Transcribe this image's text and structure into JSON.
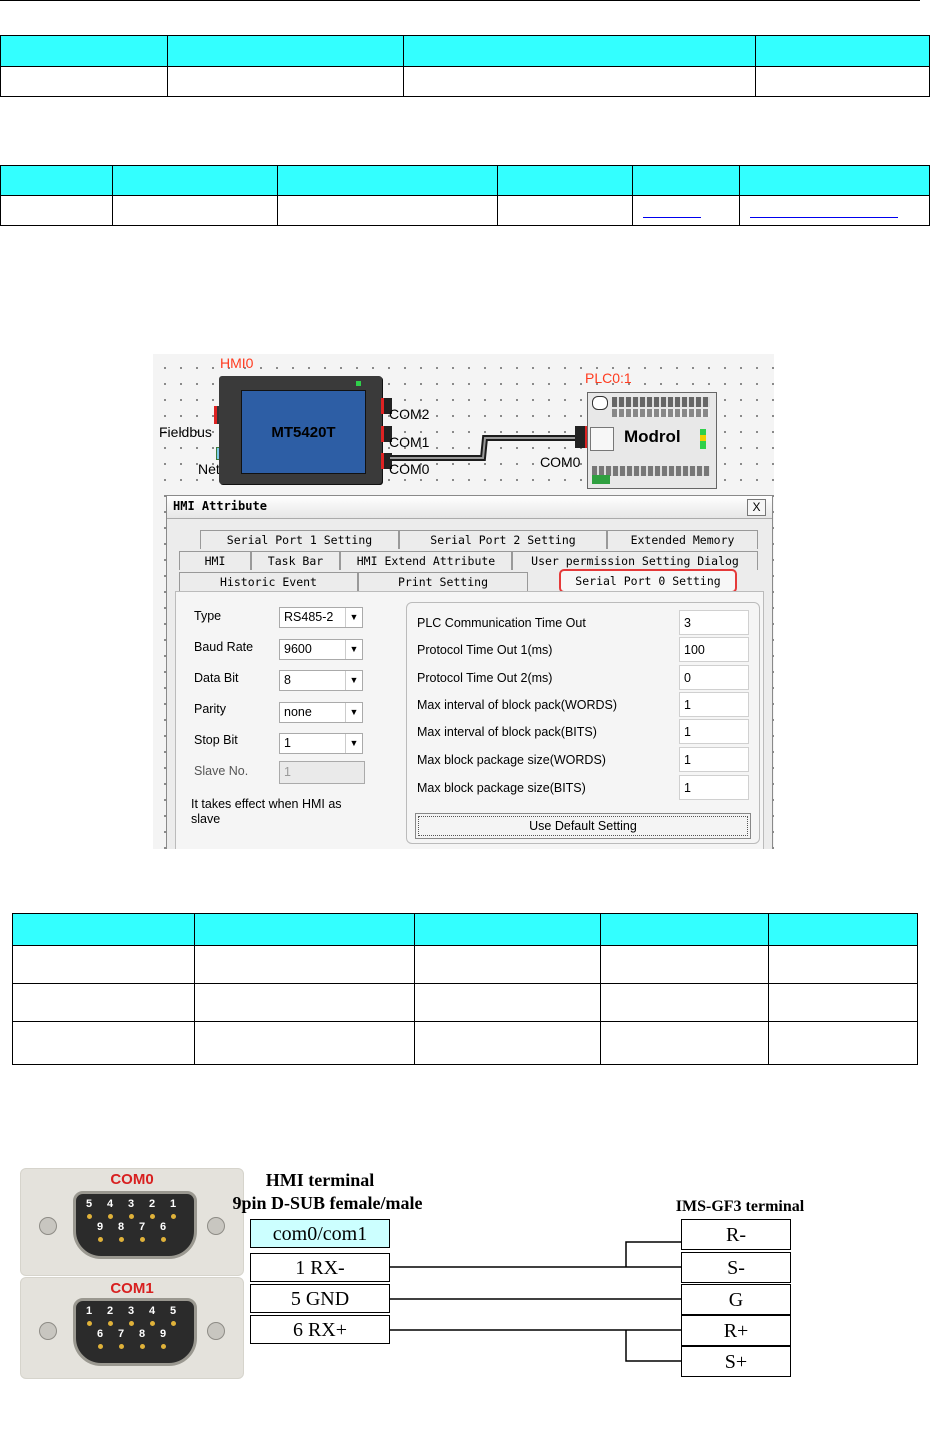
{
  "hmi_device": {
    "label": "HMI0",
    "model": "MT5420T",
    "fieldbus_label": "Fieldbus",
    "net_label": "Net",
    "ports": [
      "COM2",
      "COM1",
      "COM0"
    ]
  },
  "plc_device": {
    "label": "PLC0:1",
    "name": "Modrol",
    "port": "COM0"
  },
  "dialog": {
    "title": "HMI Attribute",
    "close": "X",
    "tabs_row1": [
      "Serial Port 1 Setting",
      "Serial Port 2 Setting",
      "Extended Memory"
    ],
    "tabs_row2": [
      "HMI",
      "Task Bar",
      "HMI Extend Attribute",
      "User permission Setting Dialog"
    ],
    "tabs_row3": [
      "Historic Event",
      "Print Setting",
      "Serial Port 0 Setting"
    ],
    "active_tab": "Serial Port 0 Setting",
    "fields": [
      {
        "label": "Type",
        "value": "RS485-2"
      },
      {
        "label": "Baud Rate",
        "value": "9600"
      },
      {
        "label": "Data Bit",
        "value": "8"
      },
      {
        "label": "Parity",
        "value": "none"
      },
      {
        "label": "Stop Bit",
        "value": "1"
      }
    ],
    "slave": {
      "label": "Slave No.",
      "value": "1"
    },
    "note": "It takes effect when HMI as slave",
    "params": [
      {
        "label": "PLC Communication Time Out",
        "value": "3"
      },
      {
        "label": "Protocol Time Out 1(ms)",
        "value": "100"
      },
      {
        "label": "Protocol Time Out 2(ms)",
        "value": "0"
      },
      {
        "label": "Max interval of block pack(WORDS)",
        "value": "1"
      },
      {
        "label": "Max interval of block pack(BITS)",
        "value": "1"
      },
      {
        "label": "Max block package size(WORDS)",
        "value": "1"
      },
      {
        "label": "Max block package size(BITS)",
        "value": "1"
      }
    ],
    "default_button": "Use Default Setting"
  },
  "wiring": {
    "com0_label": "COM0",
    "com1_label": "COM1",
    "com0_pins_top": [
      "5",
      "4",
      "3",
      "2",
      "1"
    ],
    "com0_pins_bottom": [
      "9",
      "8",
      "7",
      "6"
    ],
    "com1_pins_top": [
      "1",
      "2",
      "3",
      "4",
      "5"
    ],
    "com1_pins_bottom": [
      "6",
      "7",
      "8",
      "9"
    ],
    "hmi_title": "HMI terminal",
    "hmi_subtitle": "9pin D-SUB female/male",
    "hmi_header": "com0/com1",
    "hmi_pins": [
      "1 RX-",
      "5 GND",
      "6 RX+"
    ],
    "plc_title": "IMS-GF3 terminal",
    "plc_pins": [
      "R-",
      "S-",
      "G",
      "R+",
      "S+"
    ],
    "colors": {
      "header_fill": "#ccffff",
      "table_header": "#33ffff",
      "highlight": "#e53a3a"
    }
  }
}
